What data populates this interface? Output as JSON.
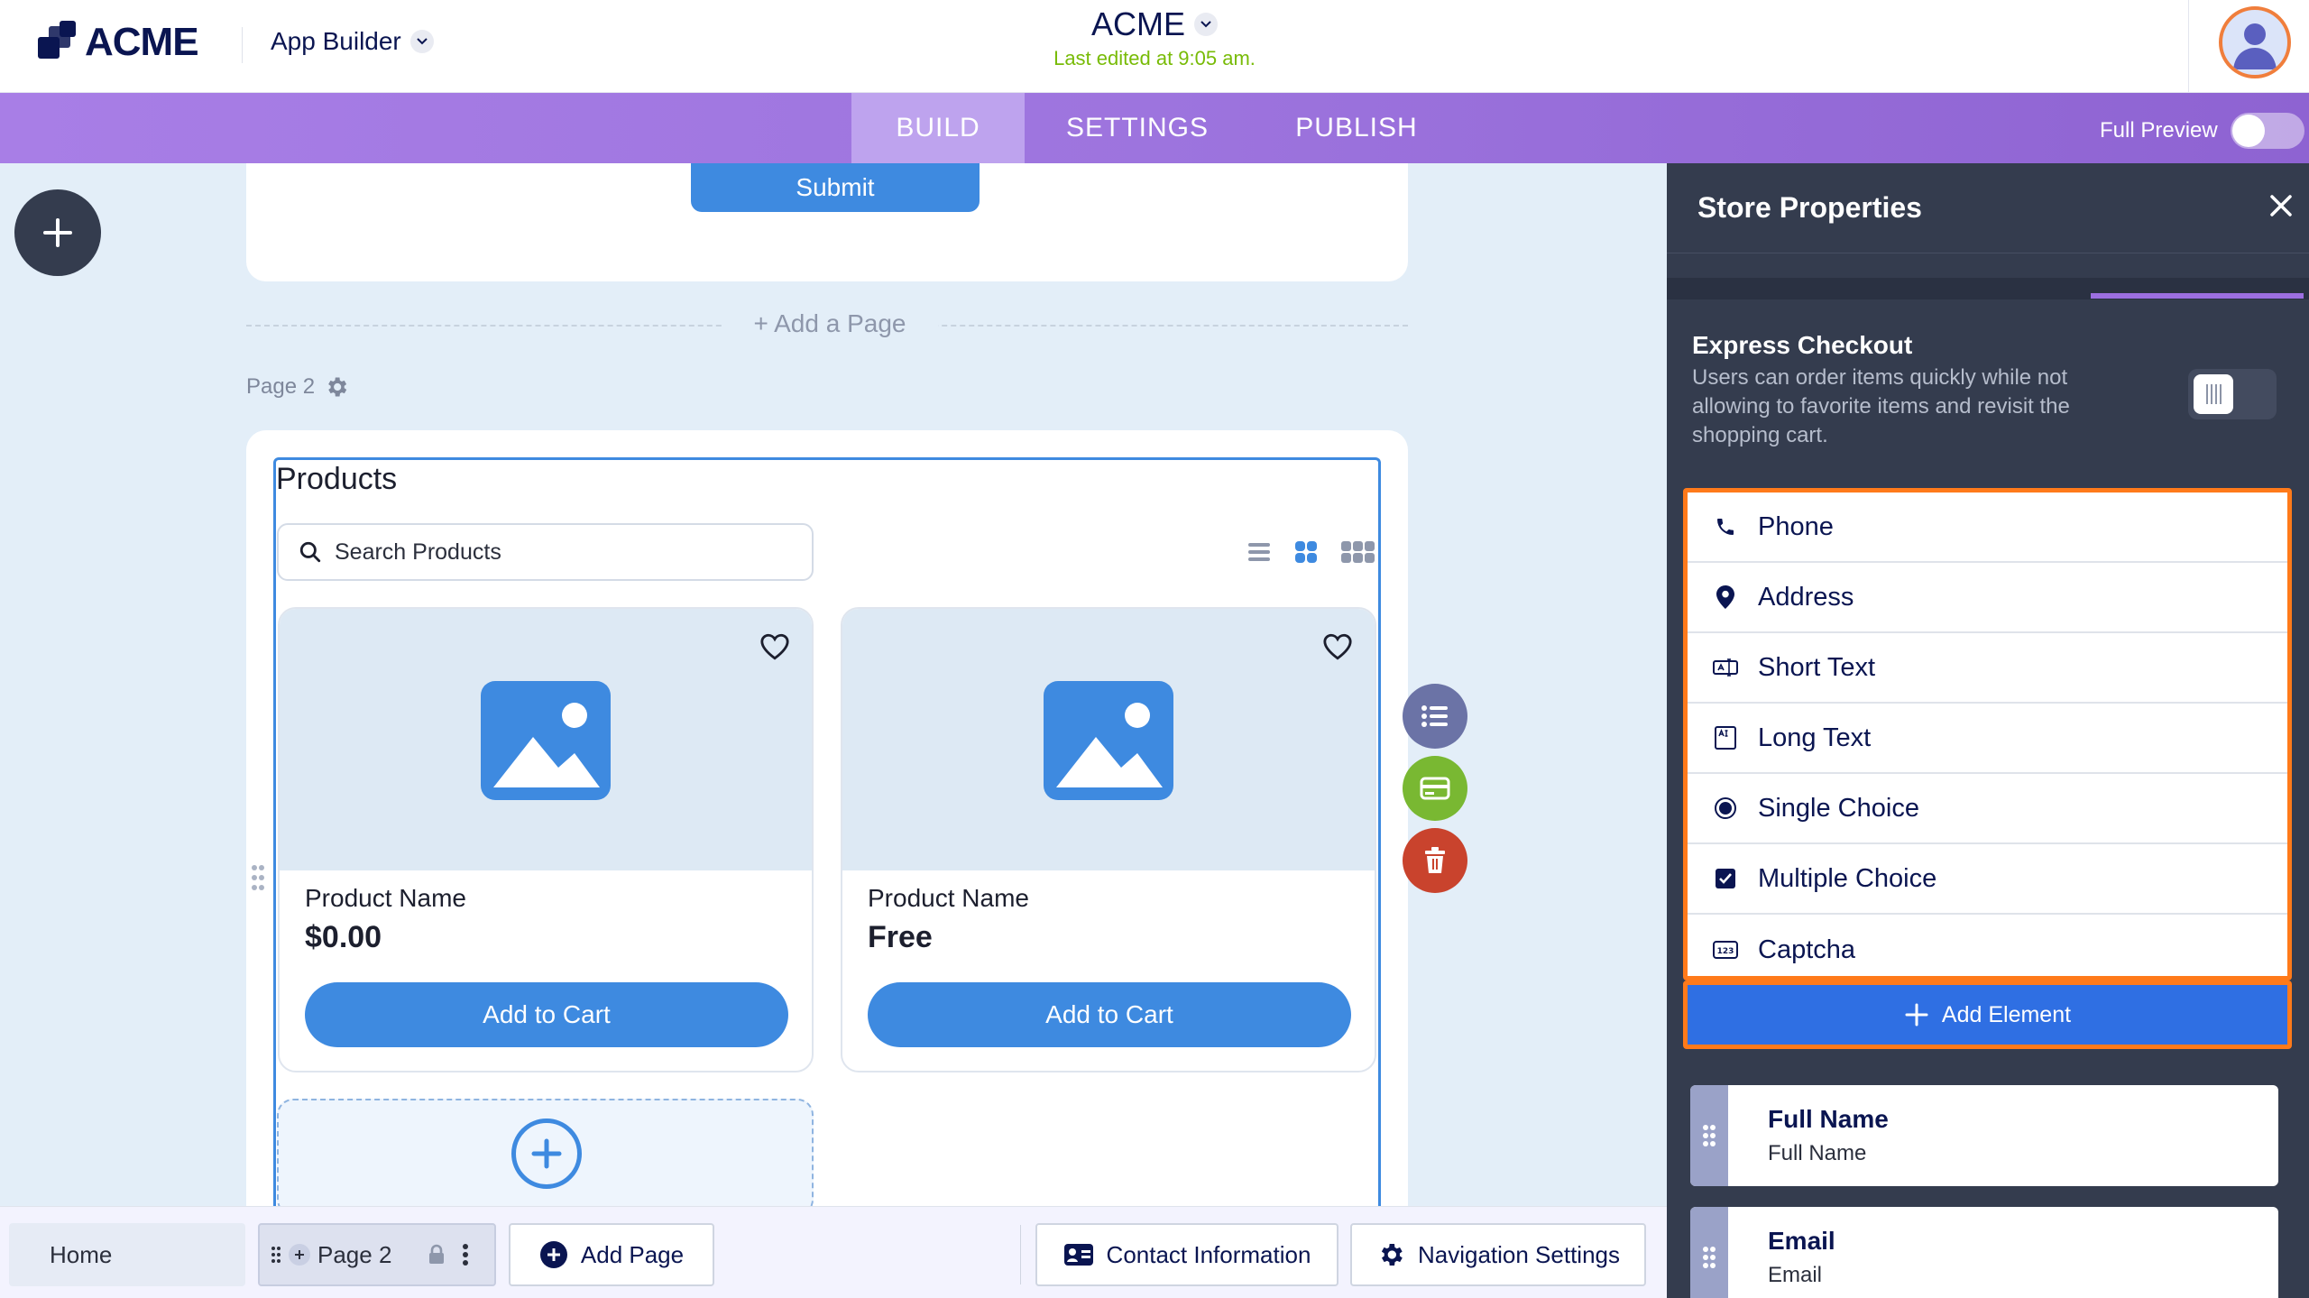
{
  "header": {
    "logo_text": "ACME",
    "app_switcher_label": "App Builder",
    "app_title": "ACME",
    "last_edited": "Last edited at 9:05 am."
  },
  "nav": {
    "tabs": [
      {
        "label": "BUILD",
        "active": true
      },
      {
        "label": "SETTINGS",
        "active": false
      },
      {
        "label": "PUBLISH",
        "active": false
      }
    ],
    "full_preview_label": "Full Preview",
    "full_preview_on": false
  },
  "canvas": {
    "submit_label": "Submit",
    "add_page_label": "+  Add a Page",
    "page_label": "Page 2",
    "products_title": "Products",
    "search_placeholder": "Search Products",
    "products": [
      {
        "name": "Product Name",
        "price": "$0.00",
        "button": "Add to Cart"
      },
      {
        "name": "Product Name",
        "price": "Free",
        "button": "Add to Cart"
      }
    ]
  },
  "bottom_bar": {
    "home": "Home",
    "page2": "Page 2",
    "add_page": "Add Page",
    "contact_info": "Contact Information",
    "nav_settings": "Navigation Settings"
  },
  "panel": {
    "title": "Store Properties",
    "express_title": "Express Checkout",
    "express_desc": "Users can order items quickly while not allowing to favorite items and revisit the shopping cart.",
    "express_on": false,
    "elements": [
      {
        "label": "Phone",
        "icon": "phone-icon"
      },
      {
        "label": "Address",
        "icon": "location-pin-icon"
      },
      {
        "label": "Short Text",
        "icon": "short-text-icon"
      },
      {
        "label": "Long Text",
        "icon": "long-text-icon"
      },
      {
        "label": "Single Choice",
        "icon": "radio-icon"
      },
      {
        "label": "Multiple Choice",
        "icon": "checkbox-icon"
      },
      {
        "label": "Captcha",
        "icon": "captcha-icon"
      }
    ],
    "add_element_label": "Add Element",
    "fields": [
      {
        "title": "Full Name",
        "sub": "Full Name"
      },
      {
        "title": "Email",
        "sub": "Email"
      }
    ]
  },
  "colors": {
    "accent_blue": "#3e8ae0",
    "highlight_orange": "#ff7a1a",
    "nav_purple": "#9d74de",
    "panel_dark": "#343c4e",
    "last_edited_green": "#78bb07"
  }
}
